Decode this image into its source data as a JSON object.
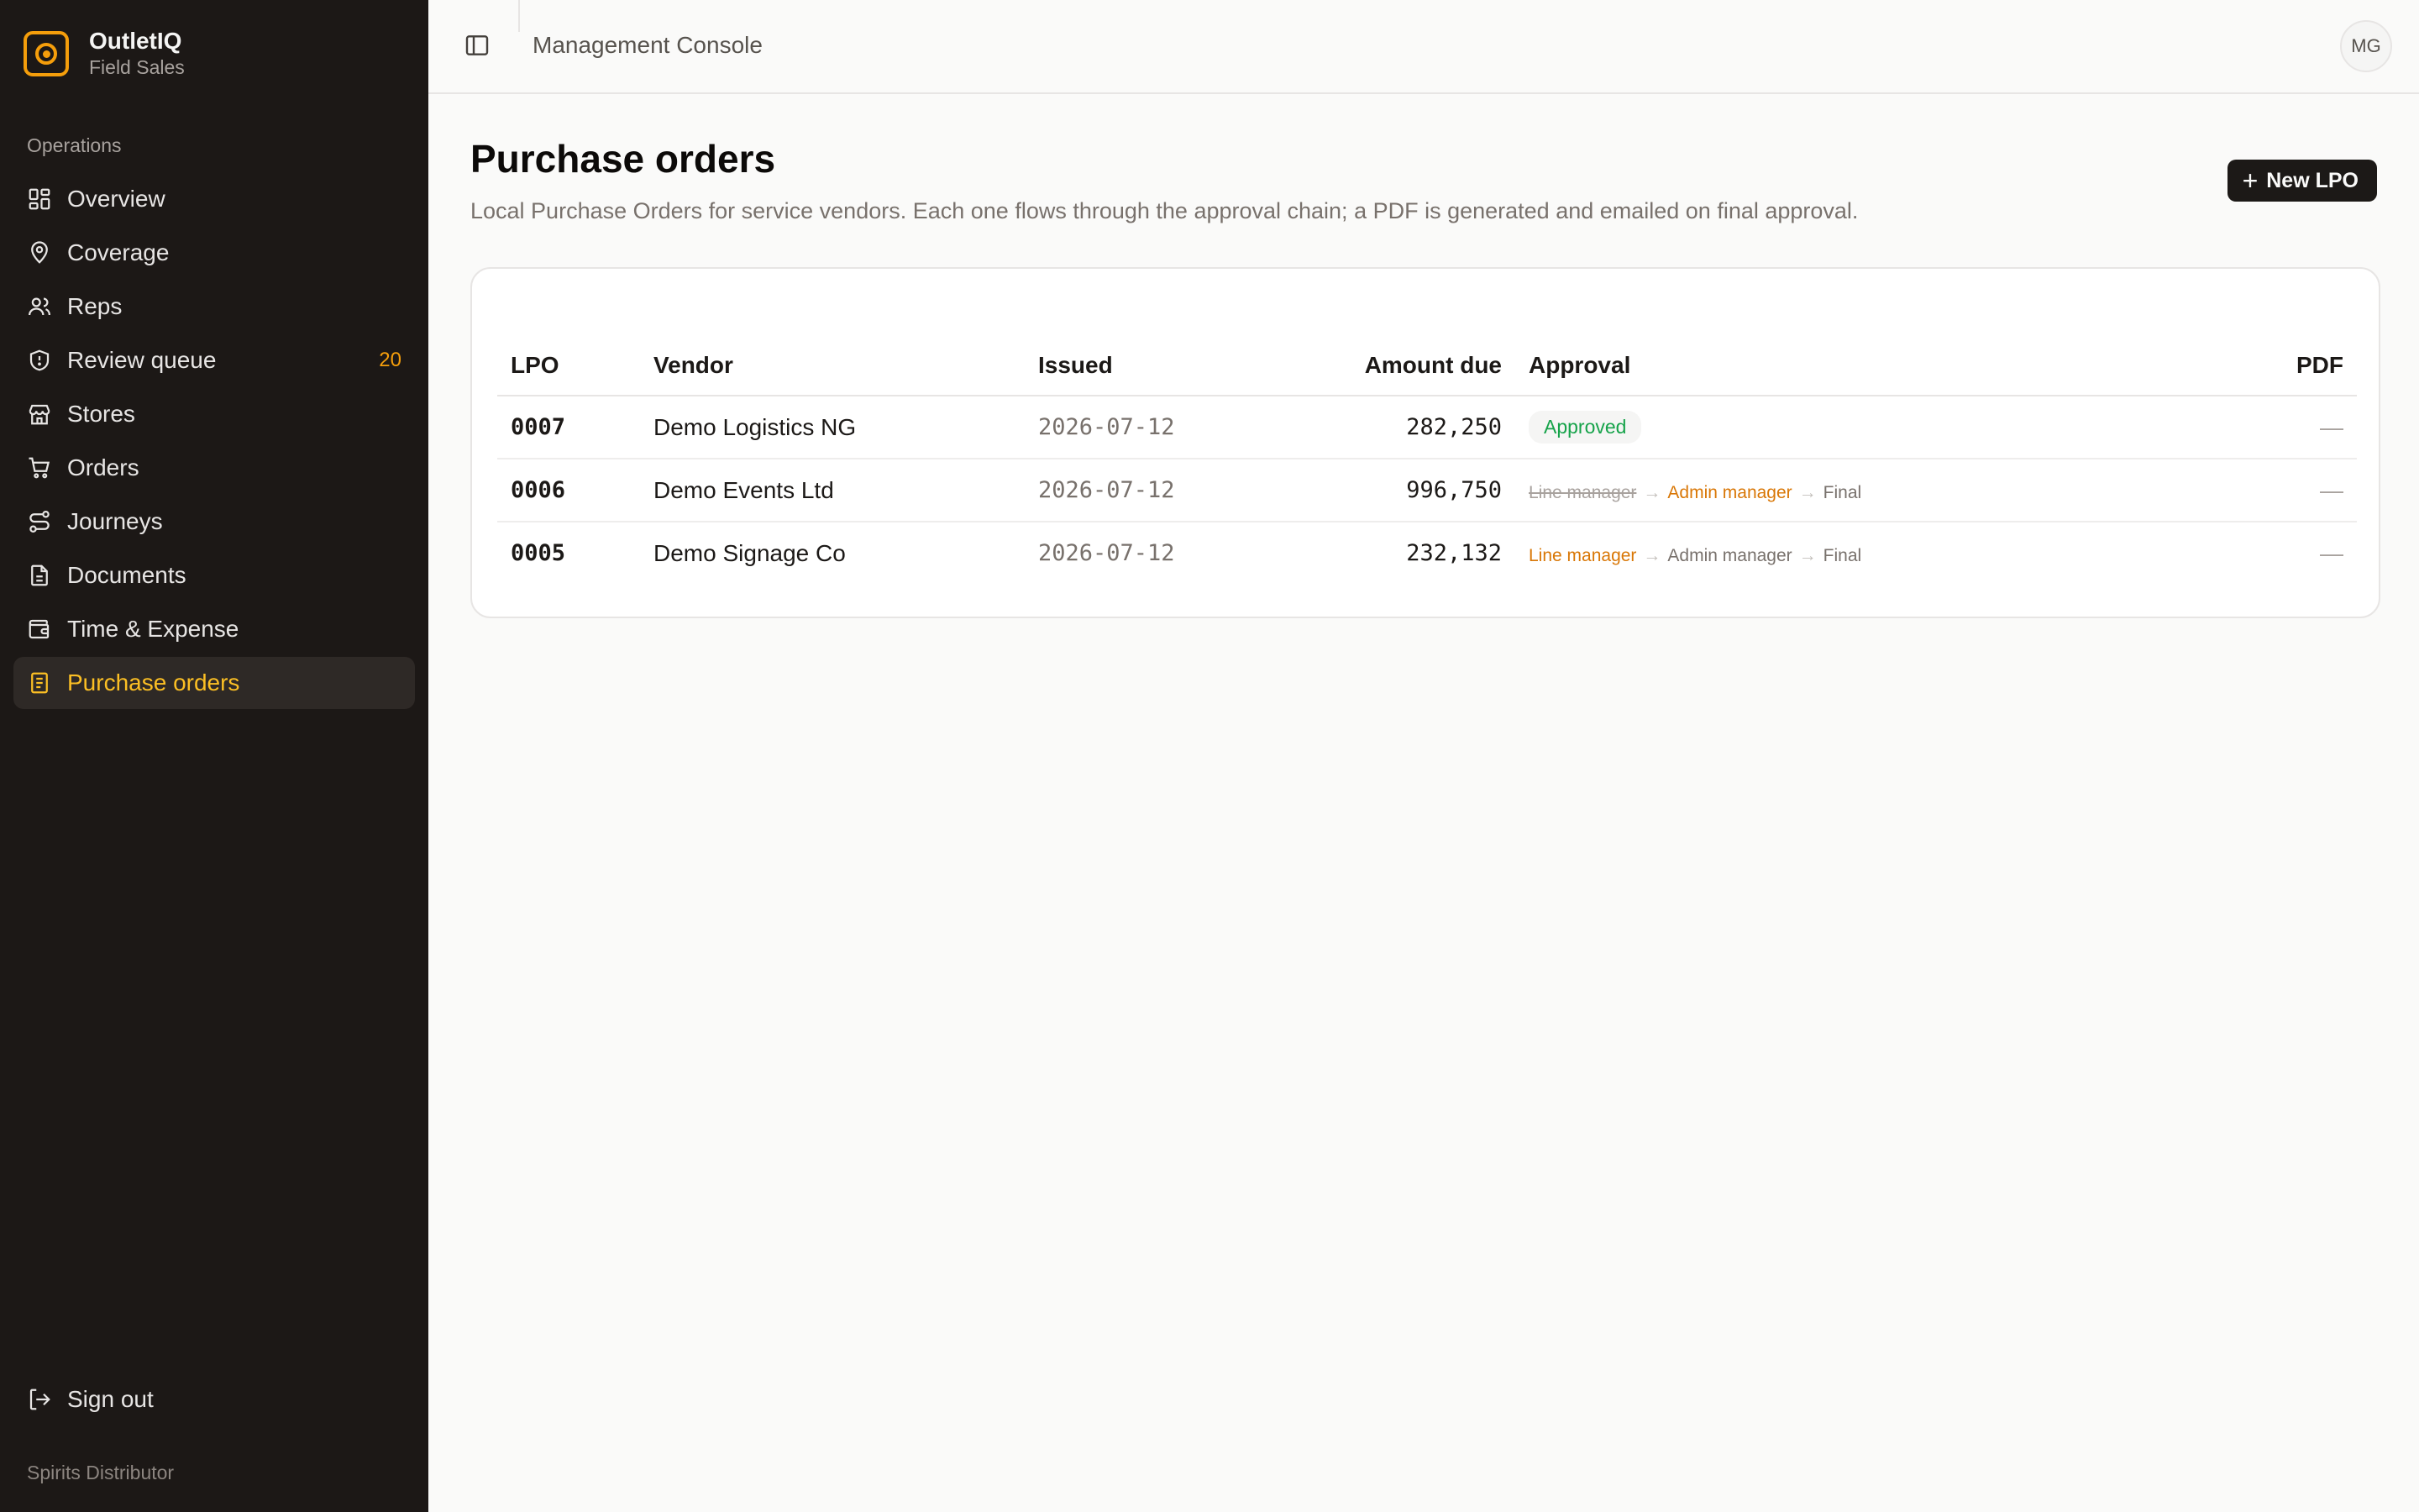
{
  "brand": {
    "name": "OutletIQ",
    "subtitle": "Field Sales"
  },
  "sidebar": {
    "section_label": "Operations",
    "items": [
      {
        "label": "Overview",
        "icon": "grid-icon"
      },
      {
        "label": "Coverage",
        "icon": "map-pin-user-icon"
      },
      {
        "label": "Reps",
        "icon": "users-icon"
      },
      {
        "label": "Review queue",
        "icon": "shield-icon",
        "badge": "20"
      },
      {
        "label": "Stores",
        "icon": "store-icon"
      },
      {
        "label": "Orders",
        "icon": "cart-icon"
      },
      {
        "label": "Journeys",
        "icon": "route-icon"
      },
      {
        "label": "Documents",
        "icon": "document-icon"
      },
      {
        "label": "Time & Expense",
        "icon": "wallet-icon"
      },
      {
        "label": "Purchase orders",
        "icon": "receipt-icon",
        "active": true
      }
    ],
    "sign_out": "Sign out",
    "org": "Spirits Distributor"
  },
  "topbar": {
    "title": "Management Console",
    "avatar_initials": "MG"
  },
  "page": {
    "title": "Purchase orders",
    "description": "Local Purchase Orders for service vendors. Each one flows through the approval chain; a PDF is generated and emailed on final approval.",
    "new_button": "New LPO"
  },
  "table": {
    "columns": [
      "LPO",
      "Vendor",
      "Issued",
      "Amount due",
      "Approval",
      "PDF"
    ],
    "rows": [
      {
        "lpo": "0007",
        "vendor": "Demo Logistics NG",
        "issued": "2026-07-12",
        "amount": "282,250",
        "approval_status": "Approved",
        "pdf": "—"
      },
      {
        "lpo": "0006",
        "vendor": "Demo Events Ltd",
        "issued": "2026-07-12",
        "amount": "996,750",
        "chain": {
          "step1": "Line manager",
          "step2": "Admin manager",
          "step3": "Final"
        },
        "pdf": "—"
      },
      {
        "lpo": "0005",
        "vendor": "Demo Signage Co",
        "issued": "2026-07-12",
        "amount": "232,132",
        "chain": {
          "step1": "Line manager",
          "step2": "Admin manager",
          "step3": "Final"
        },
        "pdf": "—"
      }
    ],
    "arrow_glyph": "→"
  },
  "colors": {
    "accent": "#f59e0b",
    "sidebar_bg": "#1c1816",
    "approved": "#16a34a",
    "current_step": "#d97706"
  }
}
